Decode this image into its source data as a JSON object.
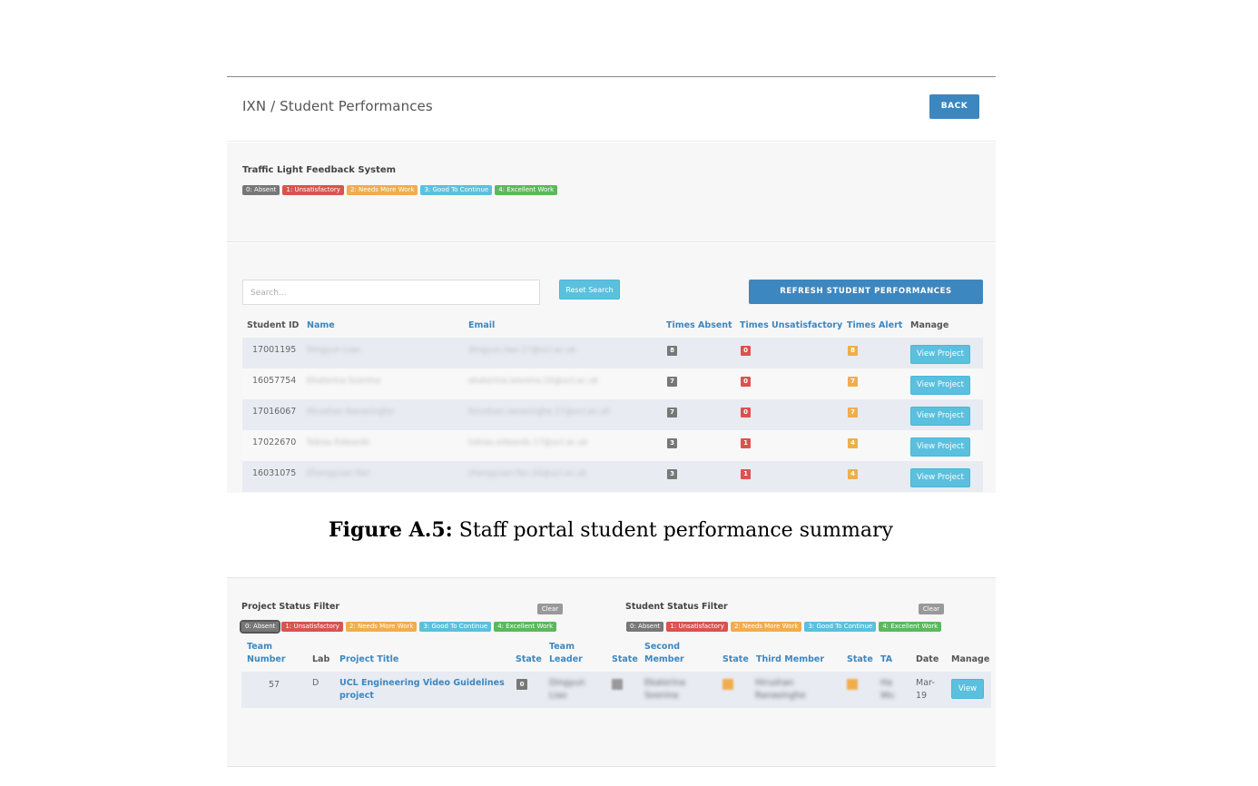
{
  "top": {
    "breadcrumb": "IXN / Student Performances",
    "back_label": "BACK",
    "legend_title": "Traffic Light Feedback System",
    "legend": [
      "0: Absent",
      "1: Unsatisfactory",
      "2: Needs More Work",
      "3: Good To Continue",
      "4: Excellent Work"
    ],
    "search_placeholder": "Search...",
    "reset_label": "Reset Search",
    "refresh_label": "REFRESH STUDENT PERFORMANCES",
    "columns": {
      "student_id": "Student ID",
      "name": "Name",
      "email": "Email",
      "times_absent": "Times Absent",
      "times_unsatisfactory": "Times Unsatisfactory",
      "times_alert": "Times Alert",
      "manage": "Manage"
    },
    "rows": [
      {
        "id": "17001195",
        "name": "Dingyun Liao",
        "email": "dingyun.liao.17@ucl.ac.uk",
        "absent": "8",
        "unsat": "0",
        "alert": "8",
        "action": "View Project"
      },
      {
        "id": "16057754",
        "name": "Ekaterina Sosnina",
        "email": "ekaterina.sosnina.16@ucl.ac.uk",
        "absent": "7",
        "unsat": "0",
        "alert": "7",
        "action": "View Project"
      },
      {
        "id": "17016067",
        "name": "Hirushan Ranasinghe",
        "email": "hirushan.ranasinghe.17@ucl.ac.uk",
        "absent": "7",
        "unsat": "0",
        "alert": "7",
        "action": "View Project"
      },
      {
        "id": "17022670",
        "name": "Tobias Edwards",
        "email": "tobias.edwards.17@ucl.ac.uk",
        "absent": "3",
        "unsat": "1",
        "alert": "4",
        "action": "View Project"
      },
      {
        "id": "16031075",
        "name": "Zhengyuan Fan",
        "email": "zhengyuan.fan.16@ucl.ac.uk",
        "absent": "3",
        "unsat": "1",
        "alert": "4",
        "action": "View Project"
      }
    ]
  },
  "caption": {
    "label": "Figure A.5:",
    "text": " Staff portal student performance summary"
  },
  "bottom": {
    "project_filter_title": "Project Status Filter",
    "student_filter_title": "Student Status Filter",
    "clear_label": "Clear",
    "legend": [
      "0: Absent",
      "1: Unsatisfactory",
      "2: Needs More Work",
      "3: Good To Continue",
      "4: Excellent Work"
    ],
    "columns": {
      "team_number_1": "Team",
      "team_number_2": "Number",
      "lab": "Lab",
      "project_title": "Project Title",
      "state": "State",
      "team_leader_1": "Team",
      "team_leader_2": "Leader",
      "second_member_1": "Second",
      "second_member_2": "Member",
      "third_member": "Third Member",
      "ta": "TA",
      "date": "Date",
      "manage": "Manage"
    },
    "row": {
      "team_number": "57",
      "lab": "D",
      "title_1": "UCL Engineering Video Guidelines",
      "title_2": "project",
      "state": "0",
      "leader_1": "Dingyun",
      "leader_2": "Liao",
      "second_1": "Ekaterina",
      "second_2": "Sosnina",
      "third_1": "Hirushan",
      "third_2": "Ranasinghe",
      "ta_1": "Ha",
      "ta_2": "Wu",
      "date_1": "Mar-",
      "date_2": "19",
      "action": "View"
    }
  },
  "colors": {
    "absent": "#777777",
    "unsatisfactory": "#d9534f",
    "needs_more_work": "#f0ad4e",
    "good_to_continue": "#5bc0de",
    "excellent": "#5cb85c",
    "primary": "#3d87c0"
  }
}
